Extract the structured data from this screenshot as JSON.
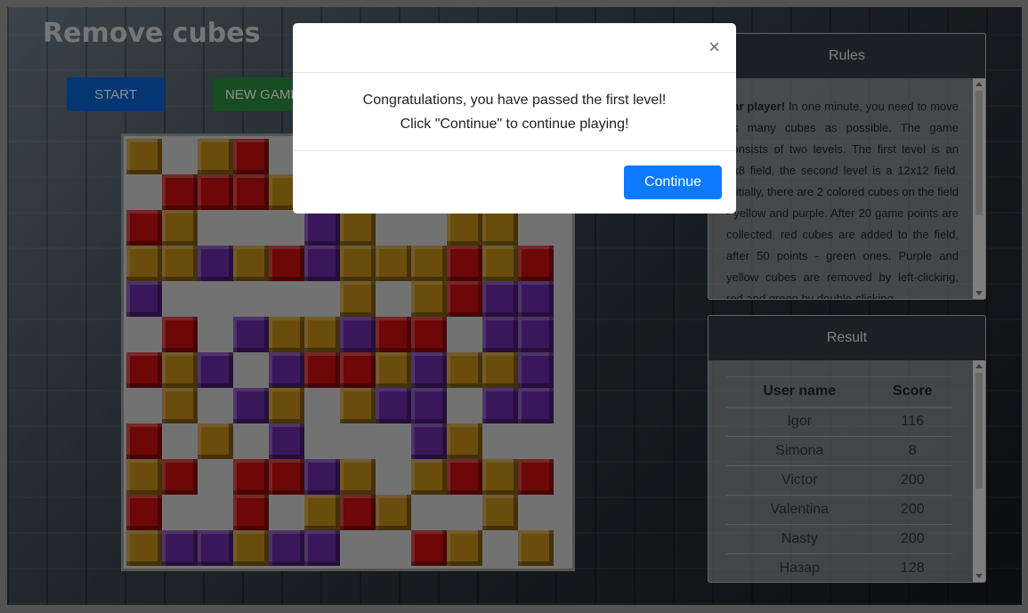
{
  "header": {
    "title": "Remove cubes"
  },
  "controls": {
    "start_label": "START",
    "new_game_label": "NEW GAME"
  },
  "board": {
    "cols": 12,
    "rows": [
      "y.yr..........",
      ".rrry.........",
      "ry...py..yy.y.",
      "yypyrpyyyryr..",
      "p.....y.yrpprp",
      ".r.pyyprr.pp..",
      "ryp.prrypyyp..",
      ".y.py.ypp.pp..",
      "r.y.p...py....",
      "yr.rrpy.yryr..",
      "r..r.yry..y...",
      "yppypp..ry.yy."
    ],
    "colors": {
      "y": "#c18a19",
      "r": "#c80d0d",
      "p": "#6a2aa6"
    }
  },
  "rules": {
    "title": "Rules",
    "bold_lead": "ear player!",
    "text": " In one minute, you need to move as many cubes as possible. The game consists of two levels. The first level is an 8x8 field, the second level is a 12x12 field. Initially, there are 2 colored cubes on the field - yellow and purple. After 20 game points are collected, red cubes are added to the field, after 50 points - green ones. Purple and yellow cubes are removed by left-clicking, red and green by double-clicking"
  },
  "result": {
    "title": "Result",
    "columns": [
      "User name",
      "Score"
    ],
    "rows": [
      {
        "name": "Igor",
        "score": "116"
      },
      {
        "name": "Simona",
        "score": "8"
      },
      {
        "name": "Victor",
        "score": "200"
      },
      {
        "name": "Valentina",
        "score": "200"
      },
      {
        "name": "Nasty",
        "score": "200"
      },
      {
        "name": "Назар",
        "score": "128"
      }
    ]
  },
  "modal": {
    "close_glyph": "×",
    "line1": "Congratulations, you have passed the first level!",
    "line2": "Click \"Continue\" to continue playing!",
    "continue_label": "Continue"
  }
}
